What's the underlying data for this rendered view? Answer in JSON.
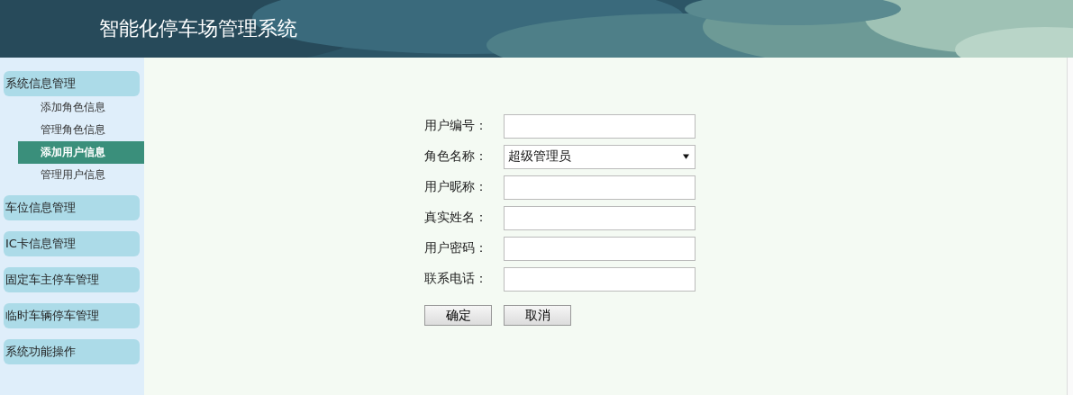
{
  "header": {
    "title": "智能化停车场管理系统"
  },
  "sidebar": {
    "groups": [
      {
        "label": "系统信息管理",
        "children": [
          {
            "label": "添加角色信息",
            "selected": false
          },
          {
            "label": "管理角色信息",
            "selected": false
          },
          {
            "label": "添加用户信息",
            "selected": true
          },
          {
            "label": "管理用户信息",
            "selected": false
          }
        ]
      },
      {
        "label": "车位信息管理"
      },
      {
        "label": "IC卡信息管理"
      },
      {
        "label": "固定车主停车管理"
      },
      {
        "label": "临时车辆停车管理"
      },
      {
        "label": "系统功能操作"
      }
    ]
  },
  "form": {
    "fields": [
      {
        "kind": "text",
        "label": "用户编号："
      },
      {
        "kind": "select",
        "label": "角色名称：",
        "value": "超级管理员"
      },
      {
        "kind": "text",
        "label": "用户昵称："
      },
      {
        "kind": "text",
        "label": "真实姓名："
      },
      {
        "kind": "text",
        "label": "用户密码："
      },
      {
        "kind": "text",
        "label": "联系电话："
      }
    ],
    "buttons": [
      "确定",
      "取消"
    ]
  }
}
